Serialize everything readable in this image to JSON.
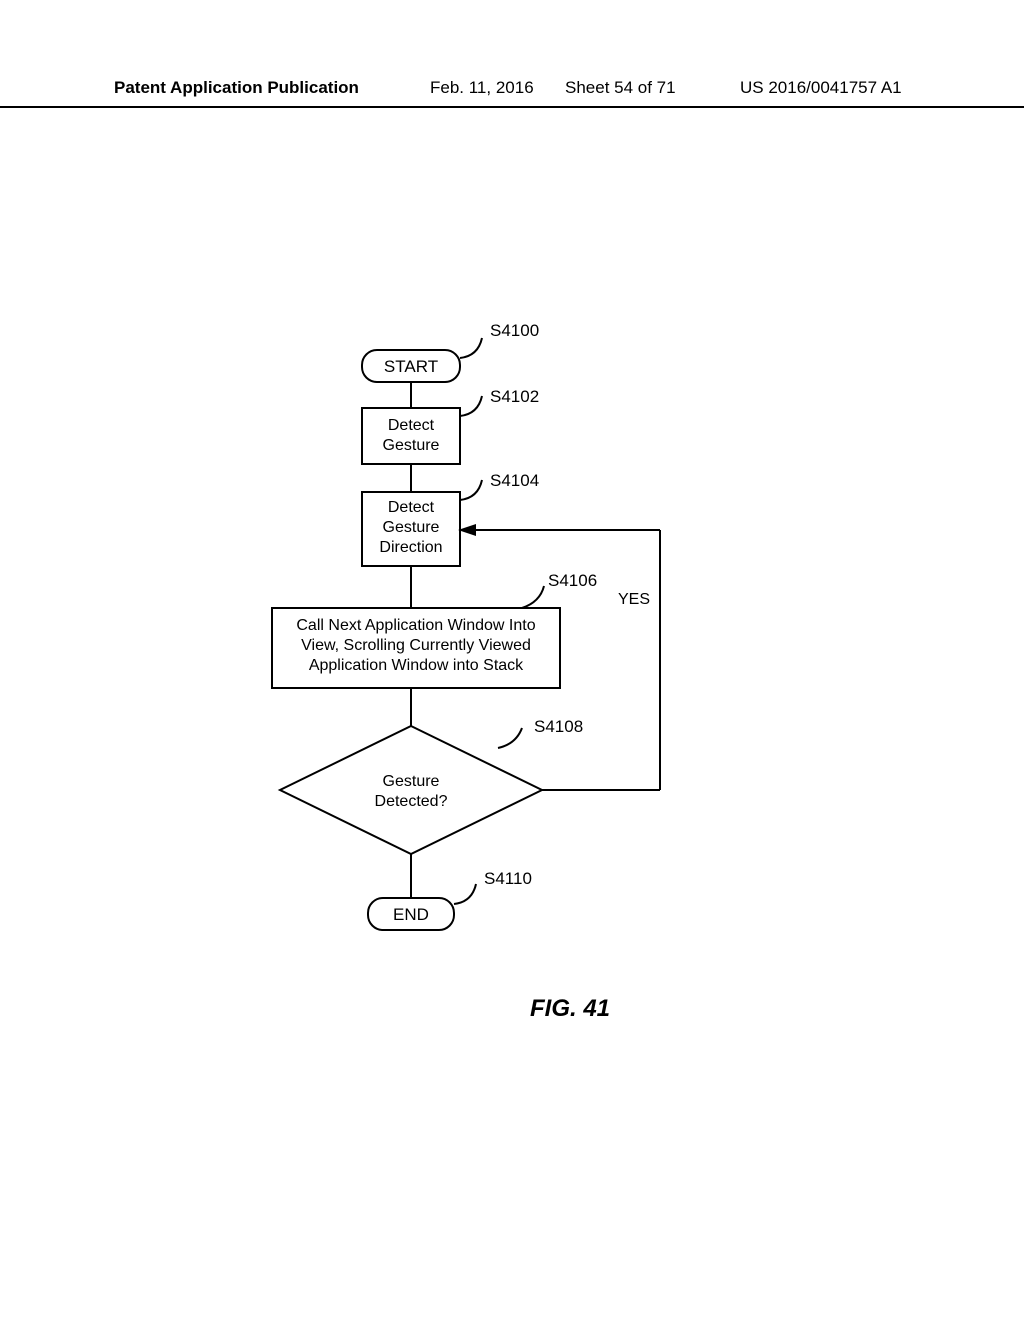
{
  "header": {
    "left": "Patent Application Publication",
    "date": "Feb. 11, 2016",
    "sheet": "Sheet 54 of 71",
    "pubnum": "US 2016/0041757 A1"
  },
  "flow": {
    "start": "START",
    "s4100": "S4100",
    "detect_gesture": "Detect\nGesture",
    "s4102": "S4102",
    "detect_direction": "Detect\nGesture\nDirection",
    "s4104": "S4104",
    "call_next": "Call Next Application Window Into\nView, Scrolling Currently Viewed\nApplication Window into Stack",
    "s4106": "S4106",
    "decision": "Gesture\nDetected?",
    "s4108": "S4108",
    "yes": "YES",
    "end": "END",
    "s4110": "S4110"
  },
  "figure": "FIG. 41"
}
